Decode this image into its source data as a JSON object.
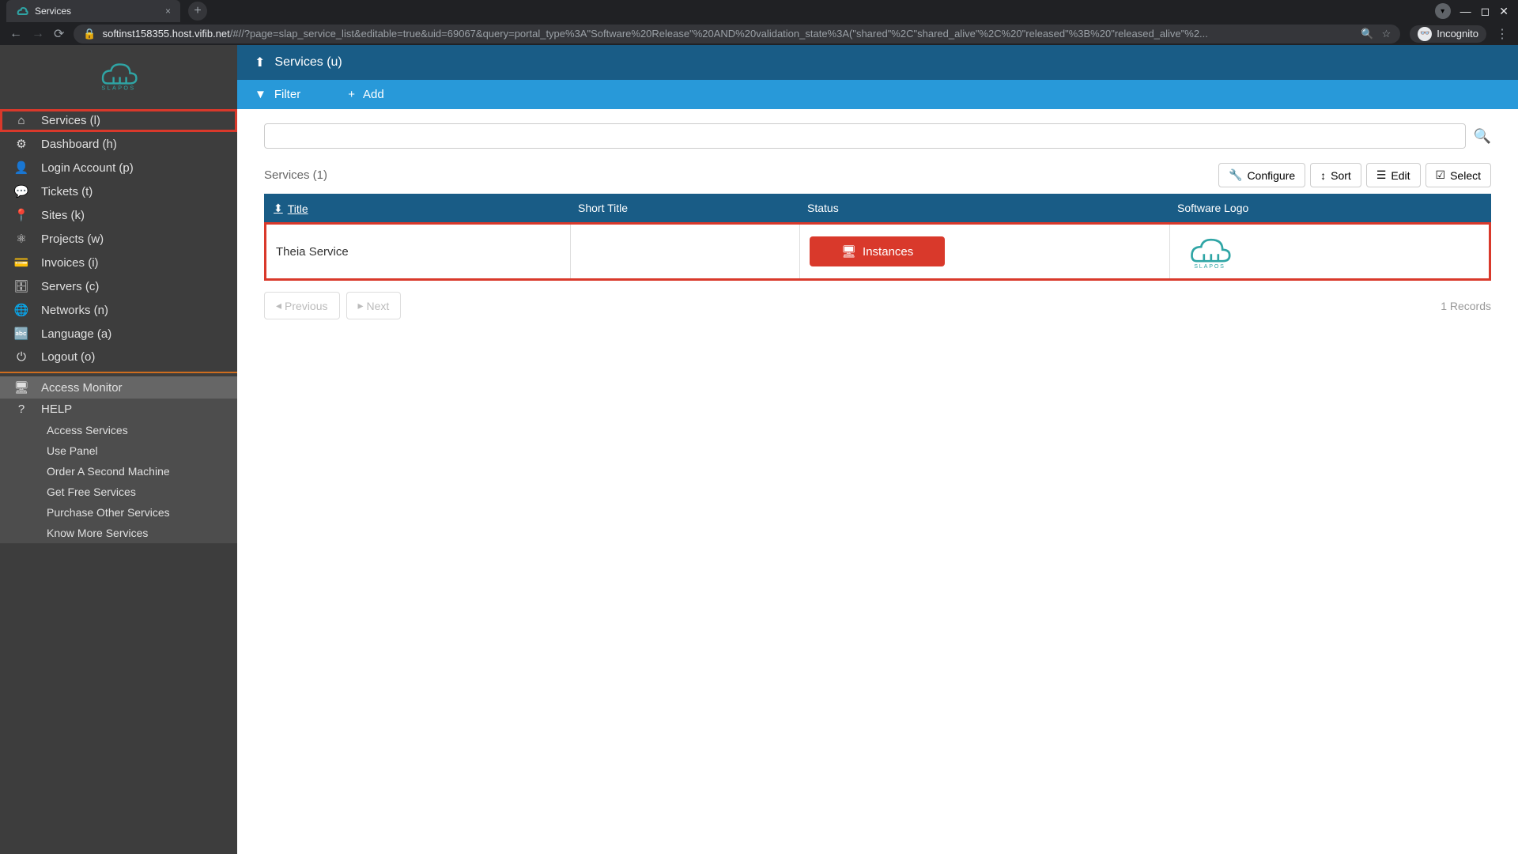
{
  "browser": {
    "tab_title": "Services",
    "url_host": "softinst158355.host.vifib.net",
    "url_path": "/#//?page=slap_service_list&editable=true&uid=69067&query=portal_type%3A\"Software%20Release\"%20AND%20validation_state%3A(\"shared\"%2C\"shared_alive\"%2C%20\"released\"%3B%20\"released_alive\"%2...",
    "incognito_label": "Incognito"
  },
  "logo_text": "SLAPOS",
  "sidebar": {
    "items": [
      {
        "label": "Services (l)",
        "icon": "home"
      },
      {
        "label": "Dashboard (h)",
        "icon": "dashboard"
      },
      {
        "label": "Login Account (p)",
        "icon": "user"
      },
      {
        "label": "Tickets (t)",
        "icon": "comments"
      },
      {
        "label": "Sites (k)",
        "icon": "marker"
      },
      {
        "label": "Projects (w)",
        "icon": "share"
      },
      {
        "label": "Invoices (i)",
        "icon": "card"
      },
      {
        "label": "Servers (c)",
        "icon": "database"
      },
      {
        "label": "Networks (n)",
        "icon": "globe"
      },
      {
        "label": "Language (a)",
        "icon": "language"
      },
      {
        "label": "Logout (o)",
        "icon": "power"
      }
    ],
    "access_monitor": "Access Monitor",
    "help": "HELP",
    "help_items": [
      "Access Services",
      "Use Panel",
      "Order A Second Machine",
      "Get Free Services",
      "Purchase Other Services",
      "Know More Services"
    ]
  },
  "header": {
    "title": "Services (u)"
  },
  "toolbar": {
    "filter": "Filter",
    "add": "Add"
  },
  "list": {
    "title": "Services (1)",
    "actions": {
      "configure": "Configure",
      "sort": "Sort",
      "edit": "Edit",
      "select": "Select"
    },
    "columns": {
      "title": "Title",
      "short_title": "Short Title",
      "status": "Status",
      "software_logo": "Software Logo"
    },
    "rows": [
      {
        "title": "Theia Service",
        "short_title": "",
        "status_label": "Instances"
      }
    ],
    "pagination": {
      "previous": "Previous",
      "next": "Next",
      "records": "1 Records"
    }
  }
}
